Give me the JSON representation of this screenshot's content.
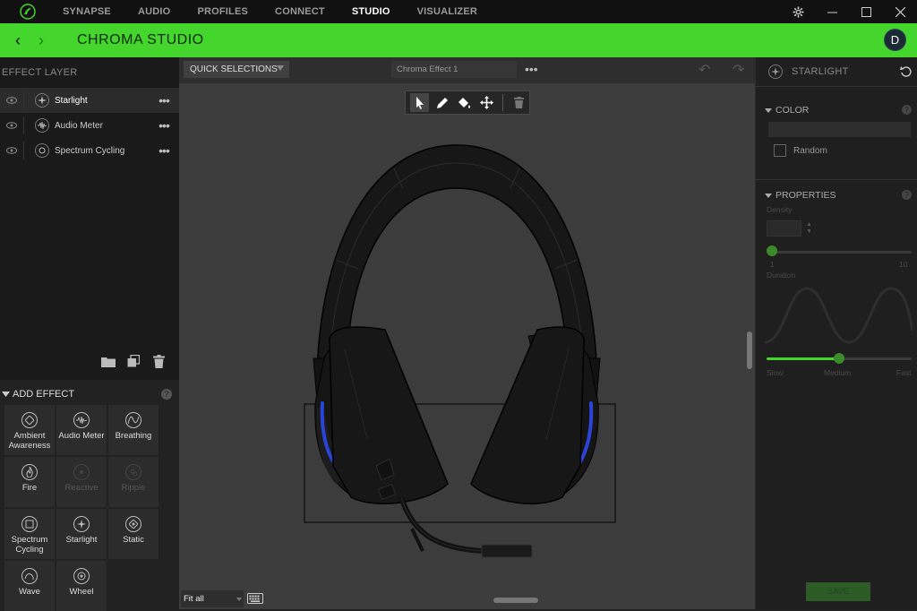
{
  "topbar": {
    "tabs": [
      {
        "label": "SYNAPSE"
      },
      {
        "label": "AUDIO"
      },
      {
        "label": "PROFILES"
      },
      {
        "label": "CONNECT"
      },
      {
        "label": "STUDIO"
      },
      {
        "label": "VISUALIZER"
      }
    ],
    "active_tab": "STUDIO"
  },
  "header": {
    "title": "CHROMA STUDIO",
    "avatar_initial": "D",
    "accent_color": "#44d62c"
  },
  "layers": {
    "heading": "EFFECT LAYER",
    "items": [
      {
        "name": "Starlight",
        "icon": "starlight-icon",
        "selected": true
      },
      {
        "name": "Audio Meter",
        "icon": "audio-meter-icon",
        "selected": false
      },
      {
        "name": "Spectrum Cycling",
        "icon": "spectrum-cycling-icon",
        "selected": false
      }
    ],
    "more_glyph": "•••"
  },
  "add_effect": {
    "heading": "ADD EFFECT",
    "help": "?",
    "tiles": [
      {
        "label": "Ambient Awareness",
        "icon": "ambient-awareness-icon",
        "enabled": true
      },
      {
        "label": "Audio Meter",
        "icon": "audio-meter-icon",
        "enabled": true
      },
      {
        "label": "Breathing",
        "icon": "breathing-icon",
        "enabled": true
      },
      {
        "label": "Fire",
        "icon": "fire-icon",
        "enabled": true
      },
      {
        "label": "Reactive",
        "icon": "reactive-icon",
        "enabled": false
      },
      {
        "label": "Ripple",
        "icon": "ripple-icon",
        "enabled": false
      },
      {
        "label": "Spectrum Cycling",
        "icon": "spectrum-cycling-icon",
        "enabled": true
      },
      {
        "label": "Starlight",
        "icon": "starlight-icon",
        "enabled": true
      },
      {
        "label": "Static",
        "icon": "static-icon",
        "enabled": true
      },
      {
        "label": "Wave",
        "icon": "wave-icon",
        "enabled": true
      },
      {
        "label": "Wheel",
        "icon": "wheel-icon",
        "enabled": true
      }
    ]
  },
  "canvas": {
    "quick_selections": "QUICK SELECTIONS",
    "effect_name": "Chroma Effect 1",
    "more_glyph": "•••",
    "zoom": "Fit all",
    "led_color": "#2a44d8"
  },
  "properties_panel": {
    "title": "STARLIGHT",
    "color_heading": "COLOR",
    "random_label": "Random",
    "properties_heading": "PROPERTIES",
    "density_label": "Density",
    "density_min": "1",
    "density_max": "10",
    "density_fraction": 0.0,
    "duration_label": "Duration",
    "duration_fraction": 0.5,
    "speed_labels": [
      "Slow",
      "Medium",
      "Fast"
    ],
    "save_label": "SAVE",
    "help": "?"
  }
}
